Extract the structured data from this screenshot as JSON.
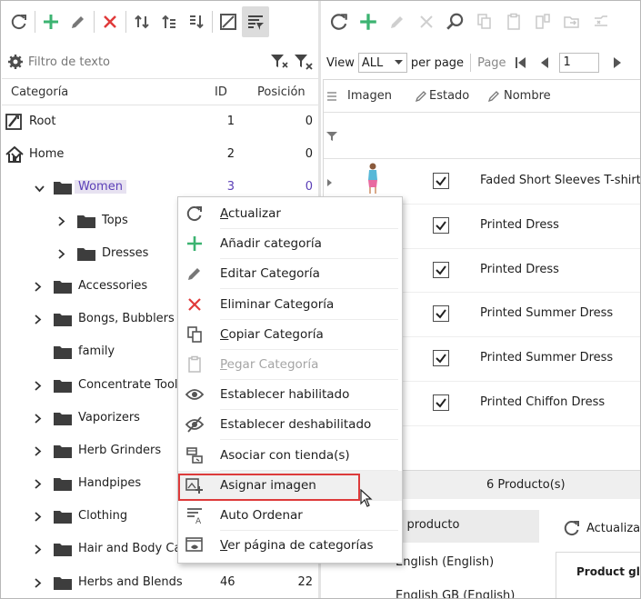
{
  "colors": {
    "green": "#3cb371",
    "red": "#e03a3a",
    "selected_text": "#5b3fb7",
    "highlight_box": "#dd3b3b"
  },
  "left_toolbar": {
    "icons": [
      "refresh-icon",
      "add-icon",
      "edit-icon",
      "delete-icon",
      "move-icon",
      "move-up-icon",
      "move-down-icon",
      "image-icon",
      "filter-rows-icon"
    ]
  },
  "filter": {
    "placeholder": "Filtro de texto"
  },
  "tree_header": {
    "category": "Categoría",
    "id": "ID",
    "position": "Posición"
  },
  "tree": [
    {
      "label": "Root",
      "id": "1",
      "pos": "0",
      "level": 0,
      "icon": "root-icon",
      "chevron": ""
    },
    {
      "label": "Home",
      "id": "2",
      "pos": "0",
      "level": 0,
      "icon": "home-icon",
      "chevron": "down"
    },
    {
      "label": "Women",
      "id": "3",
      "pos": "0",
      "level": 1,
      "icon": "folder-icon",
      "chevron": "down",
      "selected": true
    },
    {
      "label": "Tops",
      "id": "",
      "pos": "",
      "level": 2,
      "icon": "folder-icon",
      "chevron": "right"
    },
    {
      "label": "Dresses",
      "id": "",
      "pos": "",
      "level": 2,
      "icon": "folder-icon",
      "chevron": "right"
    },
    {
      "label": "Accessories",
      "id": "",
      "pos": "",
      "level": 1,
      "icon": "folder-icon",
      "chevron": "right"
    },
    {
      "label": "Bongs, Bubblers a",
      "id": "",
      "pos": "",
      "level": 1,
      "icon": "folder-icon",
      "chevron": "right"
    },
    {
      "label": "family",
      "id": "",
      "pos": "",
      "level": 1,
      "icon": "folder-icon",
      "chevron": ""
    },
    {
      "label": "Concentrate Tool",
      "id": "",
      "pos": "",
      "level": 1,
      "icon": "folder-icon",
      "chevron": "right"
    },
    {
      "label": "Vaporizers",
      "id": "",
      "pos": "",
      "level": 1,
      "icon": "folder-icon",
      "chevron": "right"
    },
    {
      "label": "Herb Grinders",
      "id": "",
      "pos": "",
      "level": 1,
      "icon": "folder-icon",
      "chevron": "right"
    },
    {
      "label": "Handpipes",
      "id": "",
      "pos": "",
      "level": 1,
      "icon": "folder-icon",
      "chevron": "right"
    },
    {
      "label": "Clothing",
      "id": "",
      "pos": "",
      "level": 1,
      "icon": "folder-icon",
      "chevron": "right"
    },
    {
      "label": "Hair and Body Ca",
      "id": "",
      "pos": "",
      "level": 1,
      "icon": "folder-icon",
      "chevron": "right"
    },
    {
      "label": "Herbs and Blends",
      "id": "46",
      "pos": "22",
      "level": 1,
      "icon": "folder-icon",
      "chevron": "right"
    }
  ],
  "right_toolbar": {
    "icons": [
      "refresh-icon",
      "add-icon",
      "edit-icon",
      "delete-icon",
      "search-icon",
      "copy-icon",
      "paste-icon",
      "duplicate-icon",
      "move-icon",
      "unlink-icon"
    ]
  },
  "pager": {
    "view": "View",
    "view_value": "ALL",
    "per_page": "per page",
    "page": "Page",
    "page_value": "1"
  },
  "product_header": {
    "image": "Imagen",
    "status": "Estado",
    "name": "Nombre"
  },
  "products": [
    {
      "name": "Faded Short Sleeves T-shirt",
      "checked": true,
      "has_image": true
    },
    {
      "name": "Printed Dress",
      "checked": true,
      "has_image": false
    },
    {
      "name": "Printed Dress",
      "checked": true,
      "has_image": false
    },
    {
      "name": "Printed Summer Dress",
      "checked": true,
      "has_image": false
    },
    {
      "name": "Printed Summer Dress",
      "checked": true,
      "has_image": false
    },
    {
      "name": "Printed Chiffon Dress",
      "checked": true,
      "has_image": false
    }
  ],
  "footer": {
    "count": "6 Producto(s)"
  },
  "details": {
    "header": "les del producto",
    "languages": [
      "English (English)",
      "English GB (English)"
    ],
    "refresh": "Actualiza",
    "prop_grid": "Product glo"
  },
  "context_menu": [
    {
      "label": "Actualizar",
      "icon": "refresh-icon",
      "underline": "A",
      "rest": "ctualizar",
      "disabled": false
    },
    {
      "label": "Añadir categoría",
      "icon": "add-icon",
      "underline": "",
      "rest": "Añadir categoría",
      "disabled": false
    },
    {
      "label": "Editar Categoría",
      "icon": "edit-icon",
      "underline": "",
      "rest": "Editar Categoría",
      "disabled": false
    },
    {
      "label": "Eliminar Categoría",
      "icon": "delete-icon",
      "underline": "",
      "rest": "Eliminar Categoría",
      "disabled": false
    },
    {
      "label": "Copiar Categoría",
      "icon": "copy-icon",
      "underline": "C",
      "rest": "opiar Categoría",
      "disabled": false
    },
    {
      "label": "Pegar Categoría",
      "icon": "paste-icon",
      "underline": "P",
      "rest": "egar Categoría",
      "disabled": true
    },
    {
      "label": "Establecer habilitado",
      "icon": "eye-icon",
      "underline": "",
      "rest": "Establecer habilitado",
      "disabled": false
    },
    {
      "label": "Establecer deshabilitado",
      "icon": "eye-off-icon",
      "underline": "",
      "rest": "Establecer deshabilitado",
      "disabled": false
    },
    {
      "label": "Asociar con tienda(s)",
      "icon": "store-link-icon",
      "underline": "",
      "rest": "Asociar con tienda(s)",
      "disabled": false
    },
    {
      "label": "Asignar imagen",
      "icon": "add-image-icon",
      "underline": "",
      "rest": "Asignar imagen",
      "disabled": false,
      "highlighted": true
    },
    {
      "label": "Auto Ordenar",
      "icon": "sort-icon",
      "underline": "",
      "rest": "Auto Ordenar",
      "disabled": false
    },
    {
      "label": "Ver página de categorías",
      "icon": "view-page-icon",
      "underline": "V",
      "rest": "er página de categorías",
      "disabled": false
    }
  ]
}
